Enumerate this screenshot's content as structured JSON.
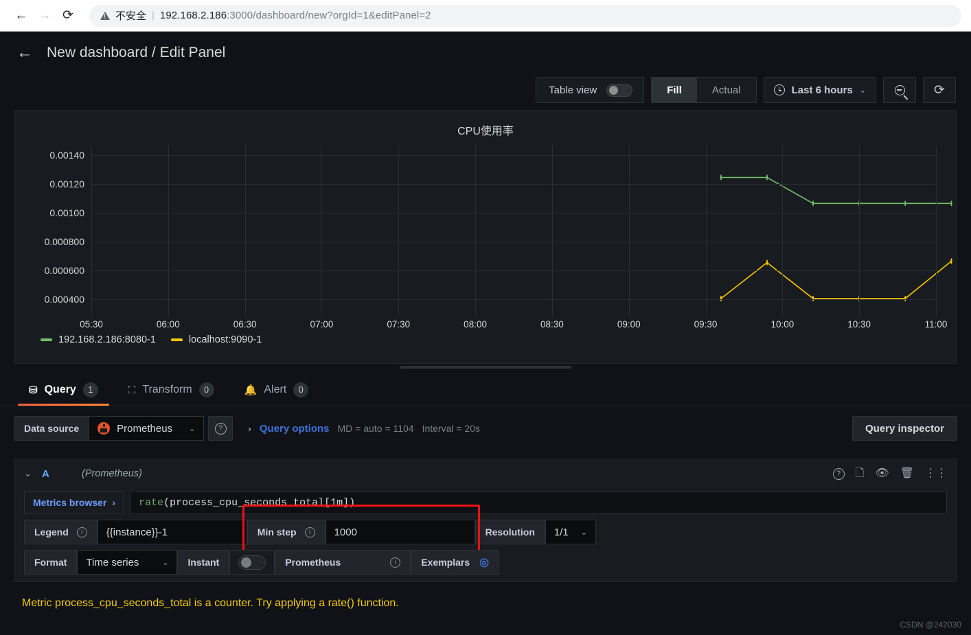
{
  "browser": {
    "back_icon": "back-arrow-icon",
    "forward_icon": "forward-arrow-icon",
    "reload_icon": "reload-icon",
    "security_label": "不安全",
    "url_host": "192.168.2.186",
    "url_rest": ":3000/dashboard/new?orgId=1&editPanel=2"
  },
  "header": {
    "back_label": "←",
    "title": "New dashboard / Edit Panel"
  },
  "toolbar": {
    "table_view_label": "Table view",
    "fill_label": "Fill",
    "actual_label": "Actual",
    "time_range": "Last 6 hours",
    "zoom_out_icon": "zoom-out-icon",
    "refresh_icon": "refresh-icon"
  },
  "panel": {
    "title": "CPU使用率"
  },
  "chart_data": {
    "type": "line",
    "title": "CPU使用率",
    "xlabel": "",
    "ylabel": "",
    "grid": true,
    "legend_position": "bottom-left",
    "x_ticks": [
      "05:30",
      "06:00",
      "06:30",
      "07:00",
      "07:30",
      "08:00",
      "08:30",
      "09:00",
      "09:30",
      "10:00",
      "10:30",
      "11:00"
    ],
    "y_ticks": [
      "0.00140",
      "0.00120",
      "0.00100",
      "0.000800",
      "0.000600",
      "0.000400"
    ],
    "ylim": [
      0.0003,
      0.0015
    ],
    "series": [
      {
        "name": "192.168.2.186:8080-1",
        "color": "#73bf69",
        "points": [
          {
            "t": "09:36",
            "v": 0.001245
          },
          {
            "t": "09:54",
            "v": 0.001245
          },
          {
            "t": "10:12",
            "v": 0.001065
          },
          {
            "t": "10:30",
            "v": 0.001065
          },
          {
            "t": "10:48",
            "v": 0.001065
          },
          {
            "t": "11:06",
            "v": 0.001065
          }
        ]
      },
      {
        "name": "localhost:9090-1",
        "color": "#fac800",
        "points": [
          {
            "t": "09:36",
            "v": 0.000405
          },
          {
            "t": "09:54",
            "v": 0.000655
          },
          {
            "t": "10:12",
            "v": 0.000405
          },
          {
            "t": "10:30",
            "v": 0.000405
          },
          {
            "t": "10:48",
            "v": 0.000405
          },
          {
            "t": "11:06",
            "v": 0.000665
          }
        ]
      }
    ]
  },
  "tabs": [
    {
      "label": "Query",
      "badge": "1",
      "icon": "database-icon",
      "active": true
    },
    {
      "label": "Transform",
      "badge": "0",
      "icon": "transform-icon",
      "active": false
    },
    {
      "label": "Alert",
      "badge": "0",
      "icon": "bell-icon",
      "active": false
    }
  ],
  "query_toolbar": {
    "data_source_label": "Data source",
    "data_source_value": "Prometheus",
    "help_icon": "question-circle-icon",
    "query_options_label": "Query options",
    "md_meta": "MD = auto = 1104",
    "interval_meta": "Interval = 20s",
    "query_inspector_label": "Query inspector"
  },
  "query_row": {
    "ref_id": "A",
    "datasource": "(Prometheus)",
    "actions": [
      "help-icon",
      "duplicate-icon",
      "eye-icon",
      "trash-icon",
      "drag-handle-icon"
    ],
    "metrics_browser_label": "Metrics browser",
    "metrics_browser_chevron": "›",
    "expression_fn": "rate",
    "expression_body": " (process_cpu_seconds_total[1m])",
    "legend_label": "Legend",
    "legend_value": "{{instance}}-1",
    "min_step_label": "Min step",
    "min_step_value": "1000",
    "resolution_label": "Resolution",
    "resolution_value": "1/1",
    "format_label": "Format",
    "format_value": "Time series",
    "instant_label": "Instant",
    "prometheus_label": "Prometheus",
    "exemplars_label": "Exemplars"
  },
  "warning": {
    "text": "Metric process_cpu_seconds_total is a counter. Try applying a rate() function."
  },
  "watermark": "CSDN @242030",
  "colors": {
    "accent_orange": "#f55f3e",
    "link_blue": "#6e9fff",
    "series_green": "#73bf69",
    "series_yellow": "#fac800",
    "warning_yellow": "#f2cc0c",
    "highlight_red": "#ee1111"
  }
}
